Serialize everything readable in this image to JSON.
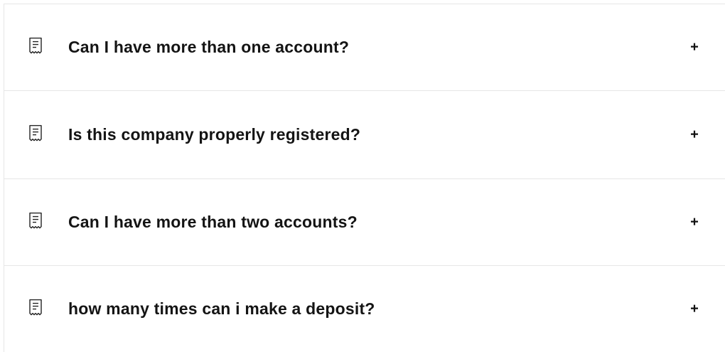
{
  "faq": {
    "items": [
      {
        "question": "Can I have more than one account?",
        "icon": "receipt-icon",
        "toggle_icon": "plus-icon"
      },
      {
        "question": "Is this company properly registered?",
        "icon": "receipt-icon",
        "toggle_icon": "plus-icon"
      },
      {
        "question": "Can I have more than two accounts?",
        "icon": "receipt-icon",
        "toggle_icon": "plus-icon"
      },
      {
        "question": "how many times can i make a deposit?",
        "icon": "receipt-icon",
        "toggle_icon": "plus-icon"
      }
    ]
  },
  "colors": {
    "divider": "#e6e6e6",
    "text": "#141414",
    "background": "#ffffff"
  }
}
